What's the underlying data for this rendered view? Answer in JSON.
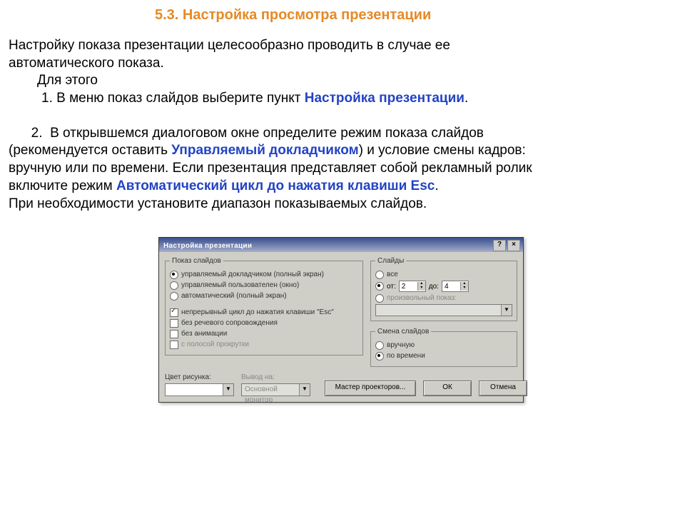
{
  "section_title": "5.3.  Настройка просмотра презентации",
  "para1_a": "Настройку показа презентации целесообразно проводить в случае ее",
  "para1_b": "автоматического показа.",
  "para1_c": "Для этого",
  "step1_prefix": "1.  В меню показ слайдов выберите пункт ",
  "step1_link": "Настройка презентации",
  "step1_suffix": ".",
  "step2_line1": "      2.  В открывшемся диалоговом окне определите режим показа слайдов",
  "step2_line2a": "(рекомендуется оставить ",
  "step2_link1": "Управляемый докладчиком",
  "step2_line2b": ") и условие смены кадров:",
  "step2_line3": "вручную или по времени. Если презентация представляет собой рекламный ролик",
  "step2_line4a": "включите режим ",
  "step2_link2": "Автоматический цикл до нажатия клавиши Esc",
  "step2_line4b": ".",
  "step2_line5": "При необходимости установите диапазон  показываемых слайдов.",
  "dialog": {
    "title": "Настройка презентации",
    "help_btn": "?",
    "close_btn": "×",
    "group_show": "Показ слайдов",
    "opt_presenter": "управляемый докладчиком (полный экран)",
    "opt_user": "управляемый пользователен (окно)",
    "opt_auto": "автоматический (полный экран)",
    "opt_loop": "непрерывный цикл до нажатия клавиши \"Esc\"",
    "opt_no_narration": "без речевого сопровождения",
    "opt_no_anim": "без анимации",
    "opt_scroll": "с полосой прокрутки",
    "group_slides": "Слайды",
    "opt_all": "все",
    "opt_from": "от:",
    "from_val": "2",
    "to_label": "до:",
    "to_val": "4",
    "opt_custom": "произвольный показ:",
    "group_advance": "Смена слайдов",
    "opt_manual": "вручную",
    "opt_timing": "по времени",
    "lbl_pen_color": "Цвет рисунка:",
    "lbl_output": "Вывод на:",
    "output_value": "Основной монитор",
    "btn_projectors": "Мастер проекторов...",
    "btn_ok": "ОК",
    "btn_cancel": "Отмена"
  }
}
